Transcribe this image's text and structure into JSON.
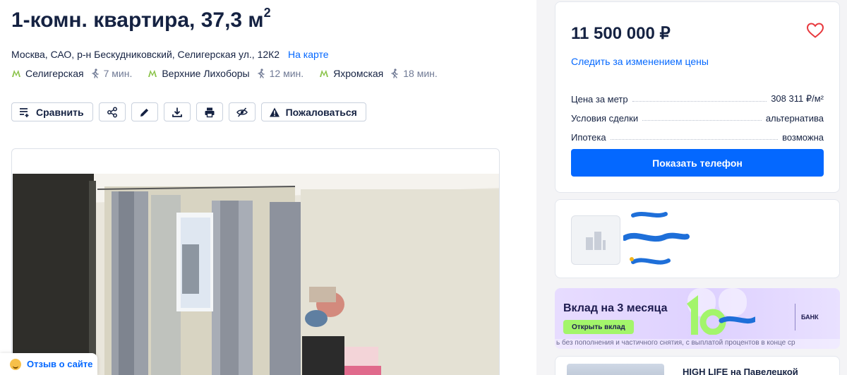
{
  "listing": {
    "title_main": "1-комн. квартира, 37,3 м",
    "title_sup": "2",
    "address": "Москва, САО, р-н Бескудниковский, Селигерская ул., 12К2",
    "map_link": "На карте",
    "metro": [
      {
        "name": "Селигерская",
        "time": "7 мин."
      },
      {
        "name": "Верхние Лихоборы",
        "time": "12 мин."
      },
      {
        "name": "Яхромская",
        "time": "18 мин."
      }
    ],
    "metro_color": "#8bc34a"
  },
  "actions": {
    "compare": "Сравнить",
    "complain": "Пожаловаться",
    "icons": [
      "compare-icon",
      "share-icon",
      "edit-icon",
      "download-icon",
      "print-icon",
      "hide-icon",
      "warning-icon"
    ]
  },
  "price_card": {
    "price": "11 500 000 ₽",
    "watch_price": "Следить за изменением цены",
    "facts": [
      {
        "key": "Цена за метр",
        "value": "308 311 ₽/м²"
      },
      {
        "key": "Условия сделки",
        "value": "альтернатива"
      },
      {
        "key": "Ипотека",
        "value": "возможна"
      }
    ],
    "show_phone": "Показать телефон"
  },
  "ad": {
    "title": "Вклад на 3 месяца",
    "button": "Открыть вклад",
    "big_number": "16",
    "bank": "БАНК",
    "footer": "ь без пополнения и частичного снятия, с выплатой процентов в конце ср"
  },
  "next_card": {
    "title": "HIGH LIFE на Павелецкой"
  },
  "feedback": {
    "label": "Отзыв о сайте"
  },
  "colors": {
    "accent": "#0468ff",
    "text": "#152242",
    "heart": "#e8383d"
  }
}
